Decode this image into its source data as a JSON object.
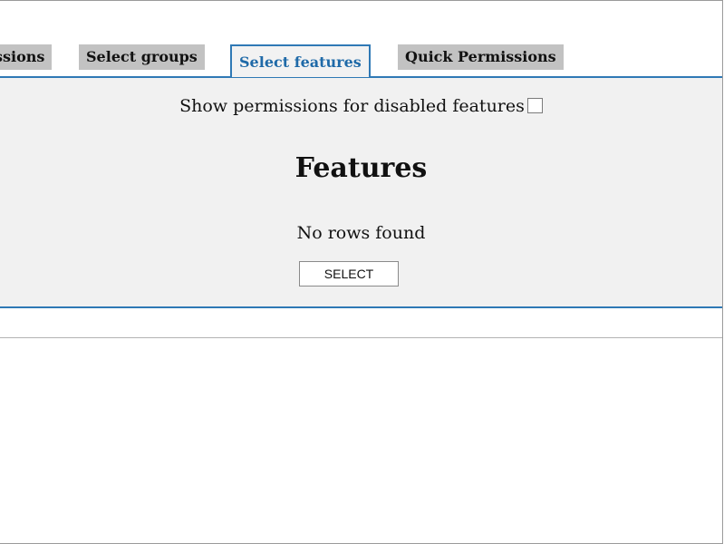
{
  "tabs": [
    {
      "label": "Permissions",
      "visible_label": "ssions",
      "active": false
    },
    {
      "label": "Select groups",
      "active": false
    },
    {
      "label": "Select features",
      "active": true
    },
    {
      "label": "Quick Permissions",
      "active": false
    }
  ],
  "panel": {
    "show_disabled_label": "Show permissions for disabled features",
    "show_disabled_checked": false,
    "title": "Features",
    "empty_message": "No rows found",
    "select_button": "SELECT"
  },
  "colors": {
    "accent": "#2f79b5",
    "active_tab_text": "#1f6aa8",
    "tab_bg": "#c2c2c2",
    "panel_bg": "#f1f1f1"
  }
}
